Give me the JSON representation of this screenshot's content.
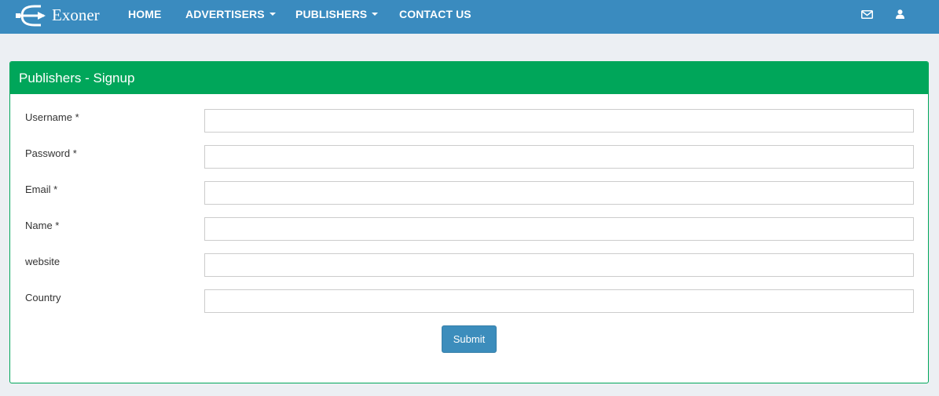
{
  "brand": {
    "name": "Exoner"
  },
  "nav": {
    "home": "HOME",
    "advertisers": "ADVERTISERS",
    "publishers": "PUBLISHERS",
    "contact": "CONTACT US"
  },
  "icons": {
    "mail": "envelope-icon",
    "user": "user-icon",
    "logo": "trident-logo-icon"
  },
  "colors": {
    "navbar": "#3a8bbf",
    "panel_header": "#00a65a",
    "submit_button": "#3c8dbc",
    "background": "#eceff3"
  },
  "panel": {
    "title": "Publishers - Signup"
  },
  "form": {
    "username": {
      "label": "Username *",
      "value": "",
      "placeholder": ""
    },
    "password": {
      "label": "Password *",
      "value": "",
      "placeholder": ""
    },
    "email": {
      "label": "Email *",
      "value": "",
      "placeholder": ""
    },
    "name": {
      "label": "Name *",
      "value": "",
      "placeholder": ""
    },
    "website": {
      "label": "website",
      "value": "",
      "placeholder": ""
    },
    "country": {
      "label": "Country",
      "value": "",
      "placeholder": ""
    },
    "submit": "Submit"
  }
}
